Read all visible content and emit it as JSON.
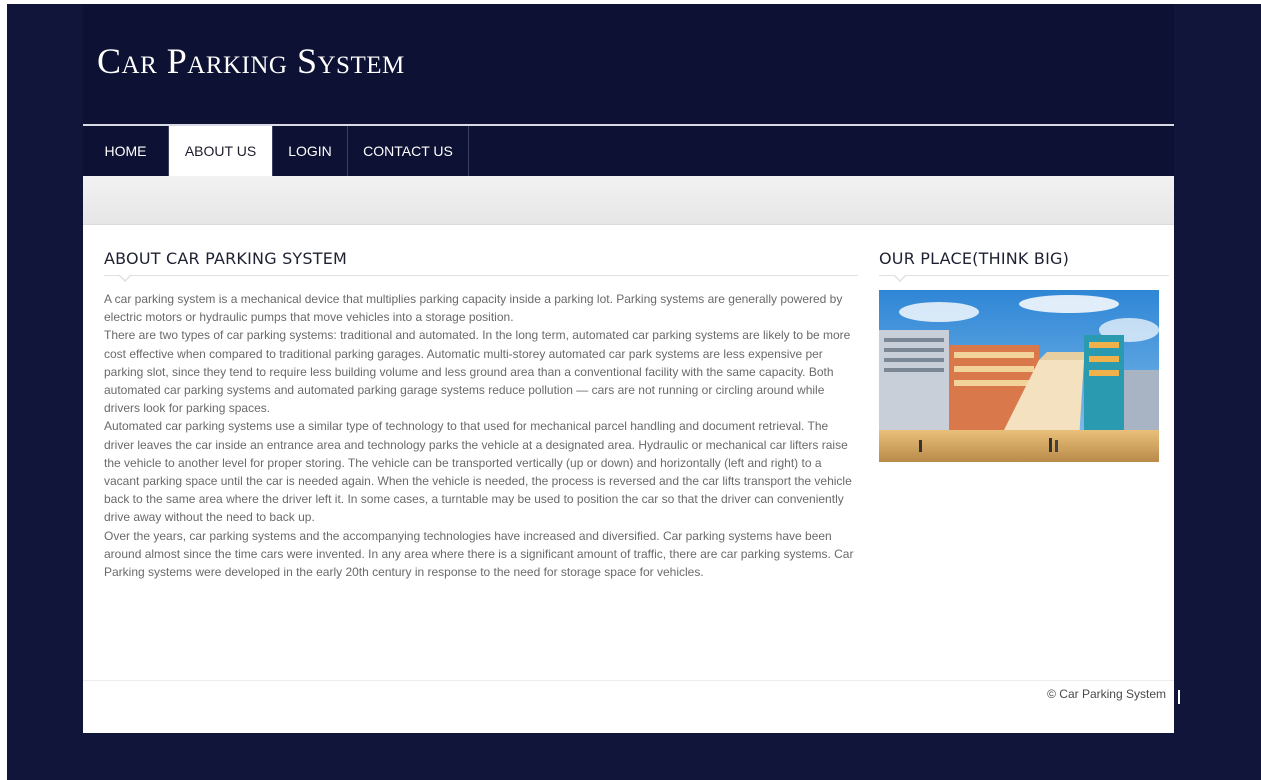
{
  "site": {
    "title": "Car Parking System"
  },
  "nav": {
    "items": [
      {
        "label": "HOME",
        "active": false
      },
      {
        "label": "ABOUT US",
        "active": true
      },
      {
        "label": "LOGIN",
        "active": false
      },
      {
        "label": "CONTACT US",
        "active": false
      }
    ]
  },
  "main": {
    "heading": "ABOUT CAR PARKING SYSTEM",
    "paragraphs": [
      "A car parking system is a mechanical device that multiplies parking capacity inside a parking lot. Parking systems are generally powered by electric motors or hydraulic pumps that move vehicles into a storage position.",
      "There are two types of car parking systems: traditional and automated. In the long term, automated car parking systems are likely to be more cost effective when compared to traditional parking garages. Automatic multi-storey automated car park systems are less expensive per parking slot, since they tend to require less building volume and less ground area than a conventional facility with the same capacity. Both automated car parking systems and automated parking garage systems reduce pollution — cars are not running or circling around while drivers look for parking spaces.",
      "Automated car parking systems use a similar type of technology to that used for mechanical parcel handling and document retrieval. The driver leaves the car inside an entrance area and technology parks the vehicle at a designated area. Hydraulic or mechanical car lifters raise the vehicle to another level for proper storing. The vehicle can be transported vertically (up or down) and horizontally (left and right) to a vacant parking space until the car is needed again. When the vehicle is needed, the process is reversed and the car lifts transport the vehicle back to the same area where the driver left it. In some cases, a turntable may be used to position the car so that the driver can conveniently drive away without the need to back up.",
      "Over the years, car parking systems and the accompanying technologies have increased and diversified. Car parking systems have been around almost since the time cars were invented. In any area where there is a significant amount of traffic, there are car parking systems. Car Parking systems were developed in the early 20th century in response to the need for storage space for vehicles."
    ]
  },
  "sidebar": {
    "heading": "OUR PLACE(THINK BIG)"
  },
  "footer": {
    "copyright": "© Car Parking System"
  },
  "colors": {
    "page_background": "#11153a",
    "header_background": "#0d1133",
    "active_tab": "#ffffff",
    "body_text": "#6a6a6a"
  }
}
